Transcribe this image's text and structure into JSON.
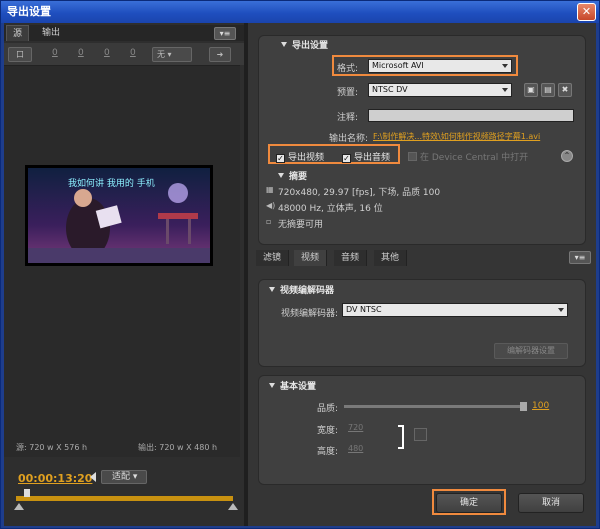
{
  "window": {
    "title": "导出设置",
    "close_icon": "close-icon"
  },
  "left": {
    "tabs": [
      {
        "label": "源"
      },
      {
        "label": "输出"
      }
    ],
    "toolbar": {
      "crop_label": "口",
      "n1": "0",
      "n2": "0",
      "n3": "0",
      "n4": "0",
      "ratio": "无"
    },
    "source_info": "源: 720 w X 576 h",
    "output_info": "输出: 720 w X 480 h",
    "timecode": "00:00:13:20",
    "fit": "适配",
    "video_caption": "我如何讲 我用的 手机"
  },
  "export": {
    "section_title": "导出设置",
    "format_label": "格式:",
    "format_value": "Microsoft AVI",
    "preset_label": "预置:",
    "preset_value": "NTSC DV",
    "comment_label": "注释:",
    "output_name_label": "输出名称:",
    "output_name_value": "F:\\制作解决...特效\\如何制作视频路径字幕1.avi",
    "export_video": "导出视频",
    "export_audio": "导出音频",
    "device_central": "在 Device Central 中打开",
    "summary_title": "摘要",
    "summary": [
      "720x480, 29.97 [fps], 下场, 品质 100",
      "48000 Hz, 立体声, 16 位",
      "无摘要可用"
    ]
  },
  "tabs2": [
    {
      "label": "滤镜"
    },
    {
      "label": "视频"
    },
    {
      "label": "音频"
    },
    {
      "label": "其他"
    }
  ],
  "codec": {
    "section_title": "视频编解码器",
    "label": "视频编解码器:",
    "value": "DV NTSC",
    "settings_button": "编解码器设置"
  },
  "basic": {
    "section_title": "基本设置",
    "quality_label": "品质:",
    "quality_value": "100",
    "width_label": "宽度:",
    "width_value": "720",
    "height_label": "高度:",
    "height_value": "480"
  },
  "footer": {
    "ok": "确定",
    "cancel": "取消"
  }
}
